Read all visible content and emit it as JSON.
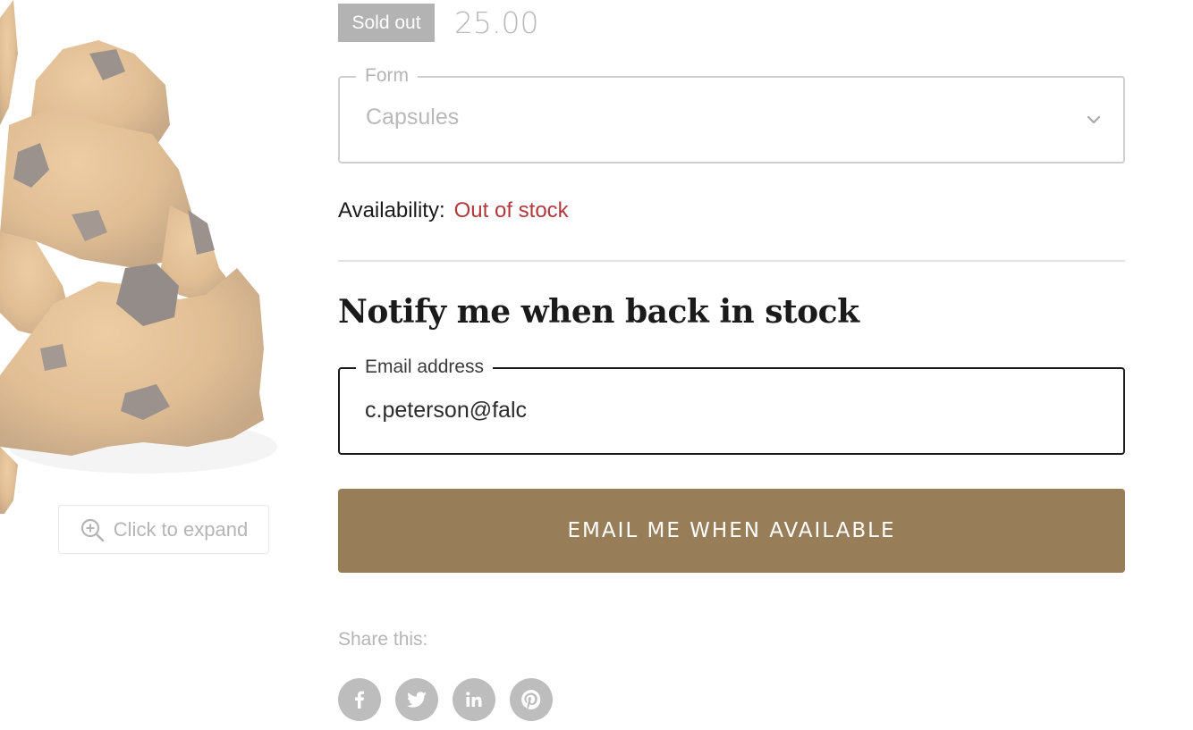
{
  "product": {
    "sold_badge": "Sold out",
    "price": "25.00",
    "expand_label": "Click to expand"
  },
  "form_select": {
    "legend": "Form",
    "value": "Capsules"
  },
  "availability": {
    "label": "Availability:",
    "status": "Out of stock"
  },
  "notify": {
    "heading": "Notify me when back in stock",
    "email_legend": "Email address",
    "email_value": "c.peterson@falc",
    "button_label": "EMAIL ME WHEN AVAILABLE"
  },
  "share": {
    "label": "Share this:",
    "icons": [
      "facebook-icon",
      "twitter-icon",
      "linkedin-icon",
      "pinterest-icon"
    ]
  },
  "colors": {
    "accent": "#977e59",
    "status_out_of_stock": "#b0393c",
    "sold_badge": "#b3b3b3"
  }
}
